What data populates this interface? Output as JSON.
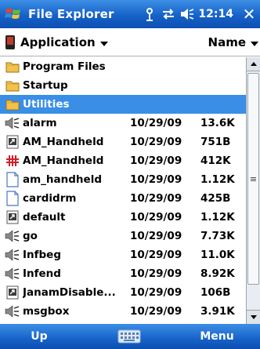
{
  "titlebar": {
    "title": "File Explorer",
    "time": "12:14",
    "icons": [
      "windows-flag-icon",
      "antenna-icon",
      "connectivity-icon",
      "speaker-icon",
      "close-icon"
    ]
  },
  "toolbar": {
    "location_label": "Application",
    "sort_label": "Name"
  },
  "files": [
    {
      "name": "Program Files",
      "date": "",
      "size": "",
      "icon": "folder-icon",
      "selected": false
    },
    {
      "name": "Startup",
      "date": "",
      "size": "",
      "icon": "folder-icon",
      "selected": false
    },
    {
      "name": "Utilities",
      "date": "",
      "size": "",
      "icon": "folder-icon",
      "selected": true
    },
    {
      "name": "alarm",
      "date": "10/29/09",
      "size": "13.6K",
      "icon": "sound-file-icon",
      "selected": false
    },
    {
      "name": "AM_Handheld",
      "date": "10/29/09",
      "size": "751B",
      "icon": "shortcut-icon",
      "selected": false
    },
    {
      "name": "AM_Handheld",
      "date": "10/29/09",
      "size": "412K",
      "icon": "program-icon",
      "selected": false
    },
    {
      "name": "am_handheld",
      "date": "10/29/09",
      "size": "1.12K",
      "icon": "document-icon",
      "selected": false
    },
    {
      "name": "cardidrm",
      "date": "10/29/09",
      "size": "425B",
      "icon": "document-icon",
      "selected": false
    },
    {
      "name": "default",
      "date": "10/29/09",
      "size": "1.12K",
      "icon": "shortcut-icon",
      "selected": false
    },
    {
      "name": "go",
      "date": "10/29/09",
      "size": "7.73K",
      "icon": "sound-file-icon",
      "selected": false
    },
    {
      "name": "Infbeg",
      "date": "10/29/09",
      "size": "11.0K",
      "icon": "sound-file-icon",
      "selected": false
    },
    {
      "name": "Infend",
      "date": "10/29/09",
      "size": "8.92K",
      "icon": "sound-file-icon",
      "selected": false
    },
    {
      "name": "JanamDisable...",
      "date": "10/29/09",
      "size": "106B",
      "icon": "shortcut-icon",
      "selected": false
    },
    {
      "name": "msgbox",
      "date": "10/29/09",
      "size": "3.91K",
      "icon": "sound-file-icon",
      "selected": false
    }
  ],
  "softkeys": {
    "left": "Up",
    "right": "Menu"
  },
  "colors": {
    "bar_blue": "#1662c9",
    "selection": "#3a8ee6",
    "folder": "#f2c14e"
  }
}
